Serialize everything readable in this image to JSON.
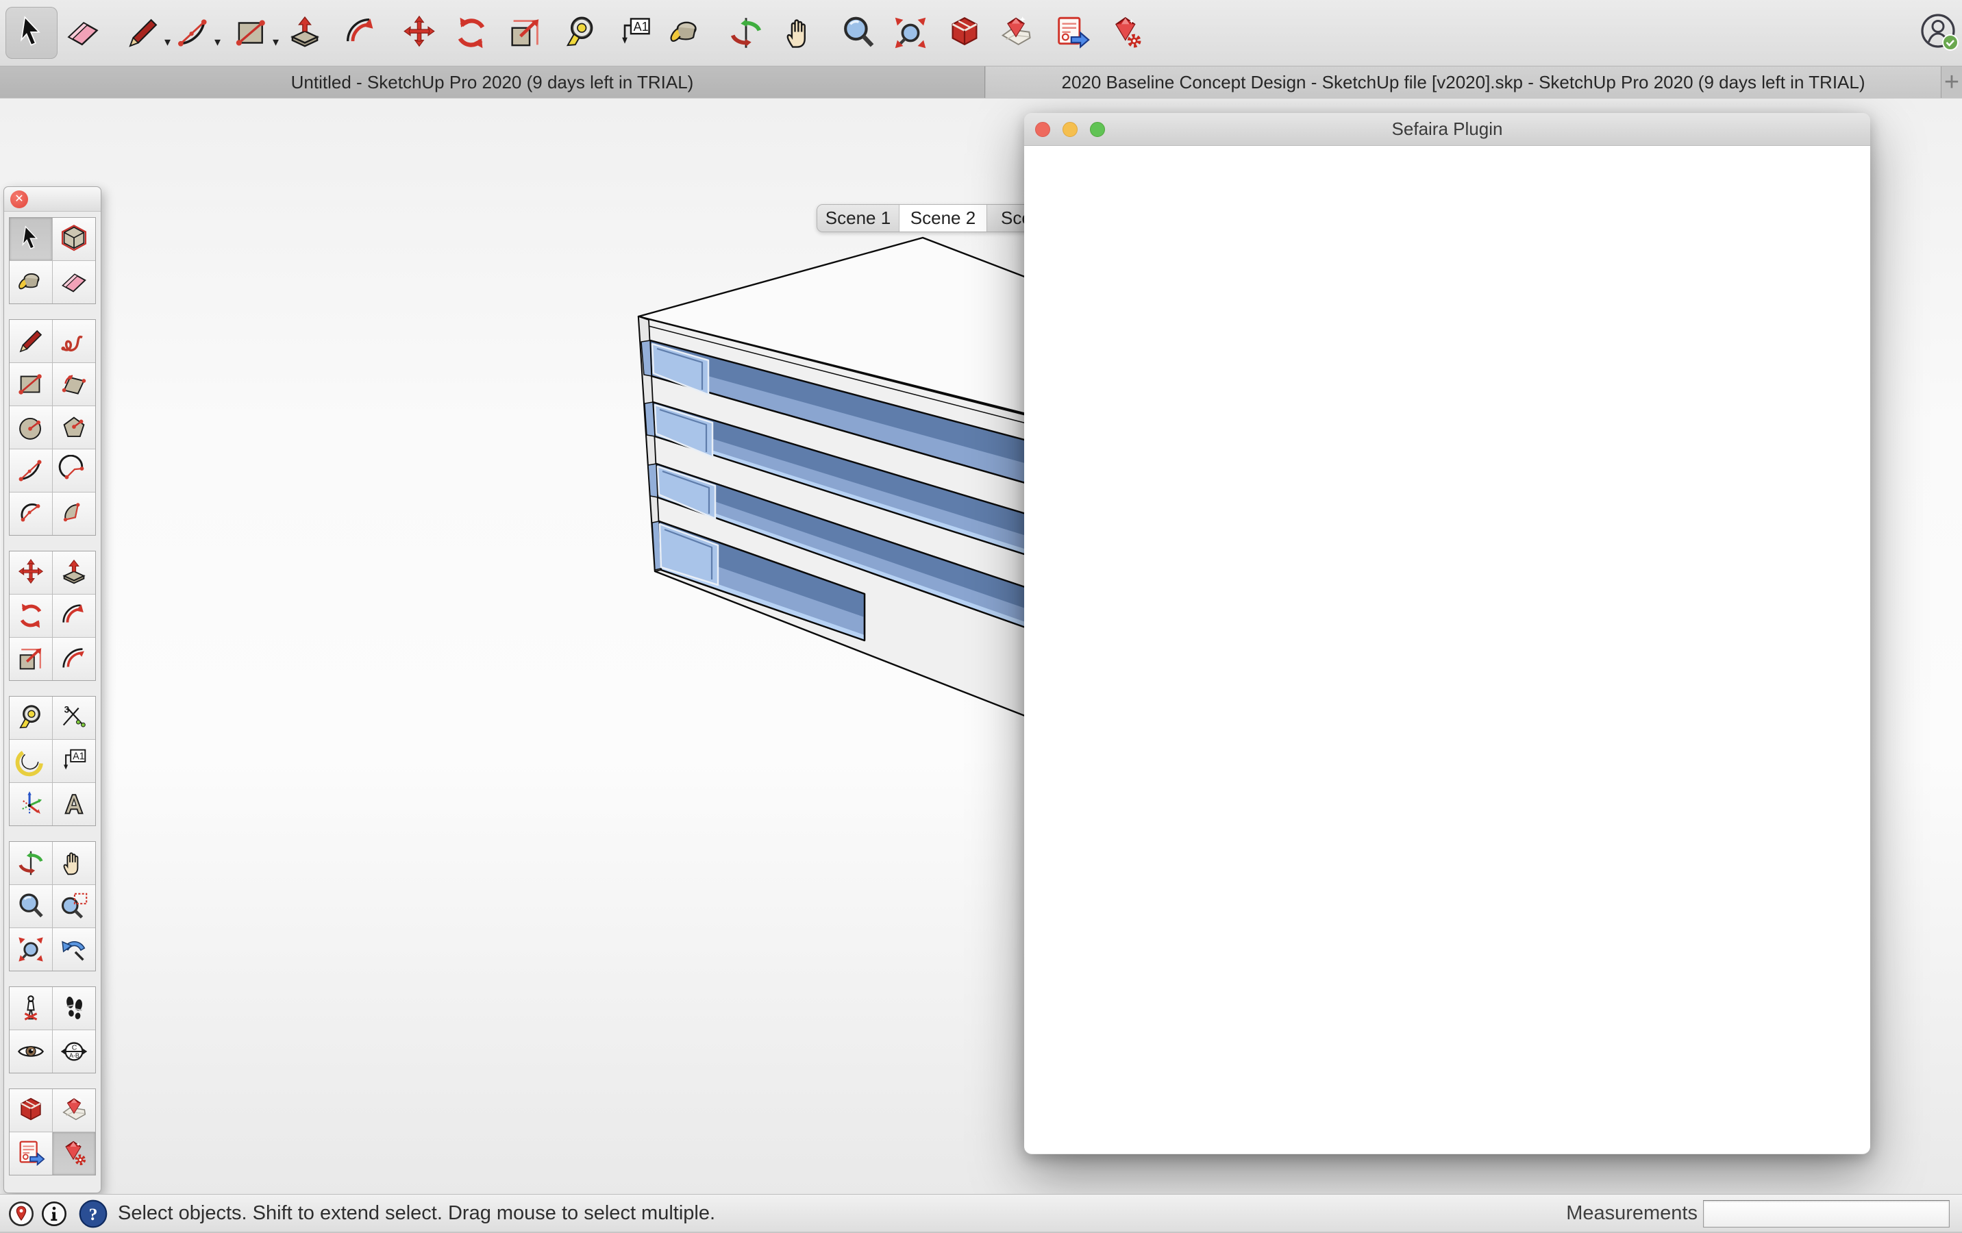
{
  "app": {
    "tabs": [
      {
        "title": "Untitled - SketchUp Pro 2020 (9 days left in TRIAL)",
        "active": false
      },
      {
        "title": "2020 Baseline Concept Design - SketchUp file [v2020].skp - SketchUp Pro 2020 (9 days left in TRIAL)",
        "active": true
      }
    ],
    "new_tab_label": "+"
  },
  "toolbar": {
    "items": [
      {
        "icon": "select",
        "active": true
      },
      {
        "icon": "eraser"
      },
      {
        "icon": "line",
        "caret": true
      },
      {
        "icon": "arc-2-point",
        "caret": true
      },
      {
        "icon": "rectangle",
        "caret": true
      },
      {
        "icon": "push-pull"
      },
      {
        "icon": "follow-me"
      },
      {
        "icon": "move"
      },
      {
        "icon": "rotate"
      },
      {
        "icon": "scale"
      },
      {
        "icon": "tape-measure"
      },
      {
        "icon": "text"
      },
      {
        "icon": "paint-bucket"
      },
      {
        "icon": "orbit"
      },
      {
        "icon": "pan"
      },
      {
        "icon": "zoom"
      },
      {
        "icon": "zoom-extents"
      },
      {
        "icon": "sefaira-entities"
      },
      {
        "icon": "sefaira-analysis"
      },
      {
        "icon": "sefaira-export"
      },
      {
        "icon": "sefaira-settings"
      }
    ]
  },
  "scene_tabs": {
    "tabs": [
      {
        "label": "Scene 1",
        "active": false
      },
      {
        "label": "Scene 2",
        "active": true
      },
      {
        "label": "Sce",
        "active": false
      }
    ]
  },
  "tool_palette": {
    "groups": [
      {
        "items": [
          {
            "icon": "select",
            "selected": true
          },
          {
            "icon": "make-component"
          },
          {
            "icon": "paint-bucket"
          },
          {
            "icon": "eraser"
          }
        ]
      },
      {
        "items": [
          {
            "icon": "line"
          },
          {
            "icon": "freehand"
          },
          {
            "icon": "rectangle"
          },
          {
            "icon": "rotated-rectangle"
          },
          {
            "icon": "circle"
          },
          {
            "icon": "polygon"
          },
          {
            "icon": "arc-2-point"
          },
          {
            "icon": "arc"
          },
          {
            "icon": "arc-3-point"
          },
          {
            "icon": "pie"
          }
        ]
      },
      {
        "items": [
          {
            "icon": "move"
          },
          {
            "icon": "push-pull"
          },
          {
            "icon": "rotate"
          },
          {
            "icon": "follow-me"
          },
          {
            "icon": "scale"
          },
          {
            "icon": "offset"
          }
        ]
      },
      {
        "items": [
          {
            "icon": "tape-measure"
          },
          {
            "icon": "dimension"
          },
          {
            "icon": "protractor"
          },
          {
            "icon": "text"
          },
          {
            "icon": "axes"
          },
          {
            "icon": "3d-text"
          }
        ]
      },
      {
        "items": [
          {
            "icon": "orbit"
          },
          {
            "icon": "pan"
          },
          {
            "icon": "zoom"
          },
          {
            "icon": "zoom-window"
          },
          {
            "icon": "zoom-extents"
          },
          {
            "icon": "previous"
          }
        ]
      },
      {
        "items": [
          {
            "icon": "position-camera"
          },
          {
            "icon": "walk"
          },
          {
            "icon": "look-around"
          },
          {
            "icon": "section-plane"
          }
        ]
      },
      {
        "items": [
          {
            "icon": "sefaira-entities"
          },
          {
            "icon": "sefaira-analysis"
          },
          {
            "icon": "sefaira-export"
          },
          {
            "icon": "sefaira-settings",
            "selected": true
          }
        ]
      }
    ]
  },
  "plugin_window": {
    "title": "Sefaira Plugin"
  },
  "status_bar": {
    "message": "Select objects. Shift to extend select. Drag mouse to select multiple.",
    "measurements_label": "Measurements",
    "measurements_value": ""
  },
  "model": {
    "glass_color": "#8aa5d0",
    "glass_dark": "#5f7dab",
    "glass_pane_light": "#a9c4e9",
    "face_color": "#f0f0f0",
    "roof_color": "#fbfbfb"
  },
  "colors": {
    "sefaira_red": "#c8291f",
    "traffic_red": "#ee6a5e",
    "traffic_yellow": "#f5bf4f",
    "traffic_green": "#61c355",
    "active_tab": "#cdcdcd",
    "inactive_tab": "#b9b9b9"
  }
}
